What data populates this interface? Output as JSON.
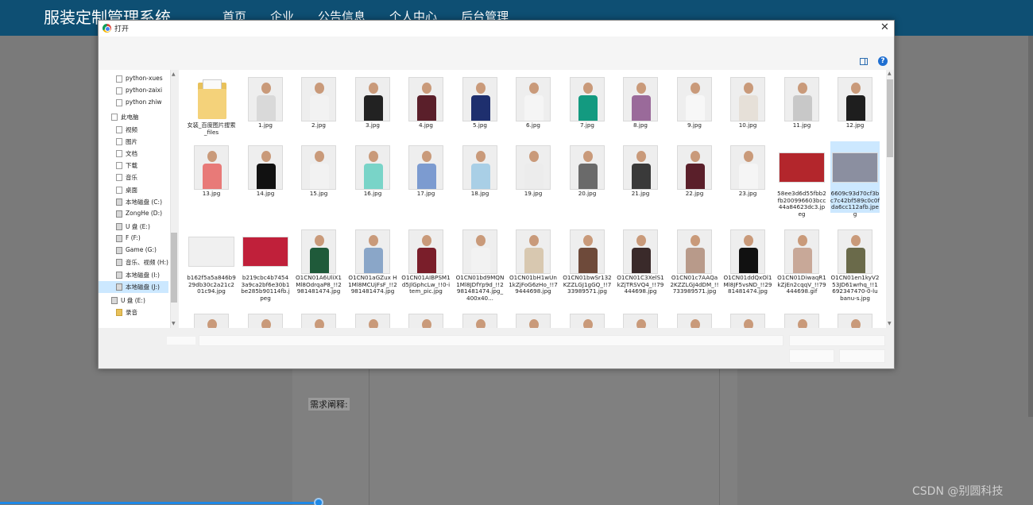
{
  "site": {
    "title": "服装定制管理系统",
    "nav": [
      "首页",
      "企业",
      "公告信息",
      "个人中心",
      "后台管理"
    ]
  },
  "form": {
    "requirement_label": "需求阐释:"
  },
  "watermark": "CSDN @别圆科技",
  "dialog": {
    "title": "打开",
    "close_icon": "close-icon",
    "nav_items": [
      {
        "label": "python-xues",
        "icon": "file",
        "pinned": true
      },
      {
        "label": "python-zaixi",
        "icon": "file",
        "pinned": true
      },
      {
        "label": "python zhiw",
        "icon": "file",
        "pinned": true
      },
      {
        "label": "此电脑",
        "icon": "computer"
      },
      {
        "label": "视频",
        "icon": "file"
      },
      {
        "label": "图片",
        "icon": "file"
      },
      {
        "label": "文档",
        "icon": "file"
      },
      {
        "label": "下载",
        "icon": "file"
      },
      {
        "label": "音乐",
        "icon": "file"
      },
      {
        "label": "桌面",
        "icon": "file"
      },
      {
        "label": "本地磁盘 (C:)",
        "icon": "drive"
      },
      {
        "label": "ZongHe (D:)",
        "icon": "drive"
      },
      {
        "label": "U 盘 (E:)",
        "icon": "drive"
      },
      {
        "label": "F (F:)",
        "icon": "drive"
      },
      {
        "label": "Game (G:)",
        "icon": "drive"
      },
      {
        "label": "音乐、视频 (H:)",
        "icon": "drive"
      },
      {
        "label": "本地磁盘 (I:)",
        "icon": "drive"
      },
      {
        "label": "本地磁盘 (J:)",
        "icon": "drive",
        "selected": true
      },
      {
        "label": "U 盘 (E:)",
        "icon": "drive"
      },
      {
        "label": "录音",
        "icon": "folder"
      }
    ],
    "files": [
      {
        "name": "女装_百度图片搜索_files",
        "type": "folder"
      },
      {
        "name": "1.jpg",
        "color": "#d9d9d9"
      },
      {
        "name": "2.jpg",
        "color": "#f2f2f2"
      },
      {
        "name": "3.jpg",
        "color": "#222222"
      },
      {
        "name": "4.jpg",
        "color": "#5a1f2a"
      },
      {
        "name": "5.jpg",
        "color": "#1e2f6e"
      },
      {
        "name": "6.jpg",
        "color": "#f5f5f5"
      },
      {
        "name": "7.jpg",
        "color": "#139a80"
      },
      {
        "name": "8.jpg",
        "color": "#9a6a9a"
      },
      {
        "name": "9.jpg",
        "color": "#f7f7f7"
      },
      {
        "name": "10.jpg",
        "color": "#e6e0d8"
      },
      {
        "name": "11.jpg",
        "color": "#c8c8c8"
      },
      {
        "name": "12.jpg",
        "color": "#1e1e1e"
      },
      {
        "name": "13.jpg",
        "color": "#e87a78"
      },
      {
        "name": "14.jpg",
        "color": "#111111"
      },
      {
        "name": "15.jpg",
        "color": "#f2f2f2"
      },
      {
        "name": "16.jpg",
        "color": "#79d4c8"
      },
      {
        "name": "17.jpg",
        "color": "#7c9bd0"
      },
      {
        "name": "18.jpg",
        "color": "#a9cfe6"
      },
      {
        "name": "19.jpg",
        "color": "#ececec"
      },
      {
        "name": "20.jpg",
        "color": "#6a6a6a"
      },
      {
        "name": "21.jpg",
        "color": "#3a3a3a"
      },
      {
        "name": "22.jpg",
        "color": "#5a1f2a"
      },
      {
        "name": "23.jpg",
        "color": "#f5f5f5"
      },
      {
        "name": "58ee3d6d55fbb2fb200996603bcc44a84623dc3.jpeg",
        "color": "#b3262c",
        "wide": true
      },
      {
        "name": "6609c93d70cf3bc7c42bf589c0c0fda6cc112afb.jpeg",
        "color": "#8b8fa0",
        "wide": true,
        "selected": true
      },
      {
        "name": "b162f5a5a846b929db30c2a21c201c94.jpg",
        "color": "#f0f0f0",
        "wide": true
      },
      {
        "name": "b219cbc4b74543a9ca2bf6e30b1be285b90114fb.jpeg",
        "color": "#c0203a",
        "wide": true
      },
      {
        "name": "O1CN01A6UliX1Ml8OdrqaP8_!!2981481474.jpg",
        "color": "#1f5a3a"
      },
      {
        "name": "O1CN01aGZux H1Ml8MCUjFsF_!!2981481474.jpg",
        "color": "#8aa6c8"
      },
      {
        "name": "O1CN01AIBPSM1d5JlGphcLw_!!0-item_pic.jpg",
        "color": "#7a1e2a"
      },
      {
        "name": "O1CN01bd9MQN1Ml8JDfYp9d_!!2981481474.jpg_400x40...",
        "color": "#f2f2f2"
      },
      {
        "name": "O1CN01bH1wUn1kZjFoG6zHo_!!79444698.jpg",
        "color": "#d8c8b0"
      },
      {
        "name": "O1CN01bwSr132KZZLGJ1gGQ_!!733989571.jpg",
        "color": "#6e4a3a"
      },
      {
        "name": "O1CN01C3XelS1kZjTRSVQ4_!!79444698.jpg",
        "color": "#3a2a2a"
      },
      {
        "name": "O1CN01c7AAQa2KZZLGJ4dDM_!!733989571.jpg",
        "color": "#b89a8a"
      },
      {
        "name": "O1CN01ddQxOl1Ml8JF5vsND_!!2981481474.jpg",
        "color": "#111111"
      },
      {
        "name": "O1CN01DiwaqR1kZjEn2cqqV_!!79444698.gif",
        "color": "#c8a898"
      },
      {
        "name": "O1CN01en1kyV253JD61wrhq_!!1692347470-0-lubanu-s.jpg",
        "color": "#6a6a4a"
      },
      {
        "name": "",
        "color": "#2a3a5a"
      },
      {
        "name": "",
        "color": "#e8e0d8"
      },
      {
        "name": "",
        "color": "#b8a8a0"
      },
      {
        "name": "",
        "color": "#2a3a6a"
      },
      {
        "name": "",
        "color": "#d8c8b8"
      },
      {
        "name": "",
        "color": "#1a1a1a"
      },
      {
        "name": "",
        "color": "#6a7a6a"
      },
      {
        "name": "",
        "color": "#d0d0d0"
      },
      {
        "name": "",
        "color": "#5a5a6a"
      },
      {
        "name": "",
        "color": "#c8b0a0"
      },
      {
        "name": "",
        "color": "#b89090"
      },
      {
        "name": "",
        "color": "#3a3a3a"
      },
      {
        "name": "",
        "color": "#8a9ab0"
      }
    ]
  },
  "colors": {
    "header": "#0e4f73",
    "selection": "#cce8ff",
    "accent": "#1e88e5"
  }
}
